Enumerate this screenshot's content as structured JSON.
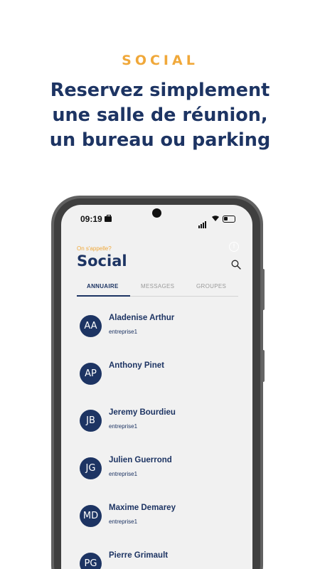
{
  "eyebrow": "SOCIAL",
  "headline": {
    "line1": "Reservez simplement",
    "line2": "une salle de réunion,",
    "line3": "un bureau ou parking"
  },
  "status_bar": {
    "time": "09:19"
  },
  "header": {
    "subtitle": "On s'appelle?",
    "title": "Social"
  },
  "tabs": [
    {
      "label": "ANNUAIRE",
      "active": true
    },
    {
      "label": "MESSAGES",
      "active": false
    },
    {
      "label": "GROUPES",
      "active": false
    }
  ],
  "contacts": [
    {
      "initials": "AA",
      "name": "Aladenise Arthur",
      "company": "entreprise1"
    },
    {
      "initials": "AP",
      "name": "Anthony Pinet",
      "company": ""
    },
    {
      "initials": "JB",
      "name": "Jeremy Bourdieu",
      "company": "entreprise1"
    },
    {
      "initials": "JG",
      "name": "Julien Guerrond",
      "company": "entreprise1"
    },
    {
      "initials": "MD",
      "name": "Maxime Demarey",
      "company": "entreprise1"
    },
    {
      "initials": "PG",
      "name": "Pierre Grimault",
      "company": ""
    }
  ],
  "colors": {
    "accent": "#F0A83A",
    "primary": "#1D3463",
    "screen_bg": "#F1F1F1"
  },
  "icons": {
    "search": "search-icon",
    "alert": "alert-circle-icon"
  }
}
